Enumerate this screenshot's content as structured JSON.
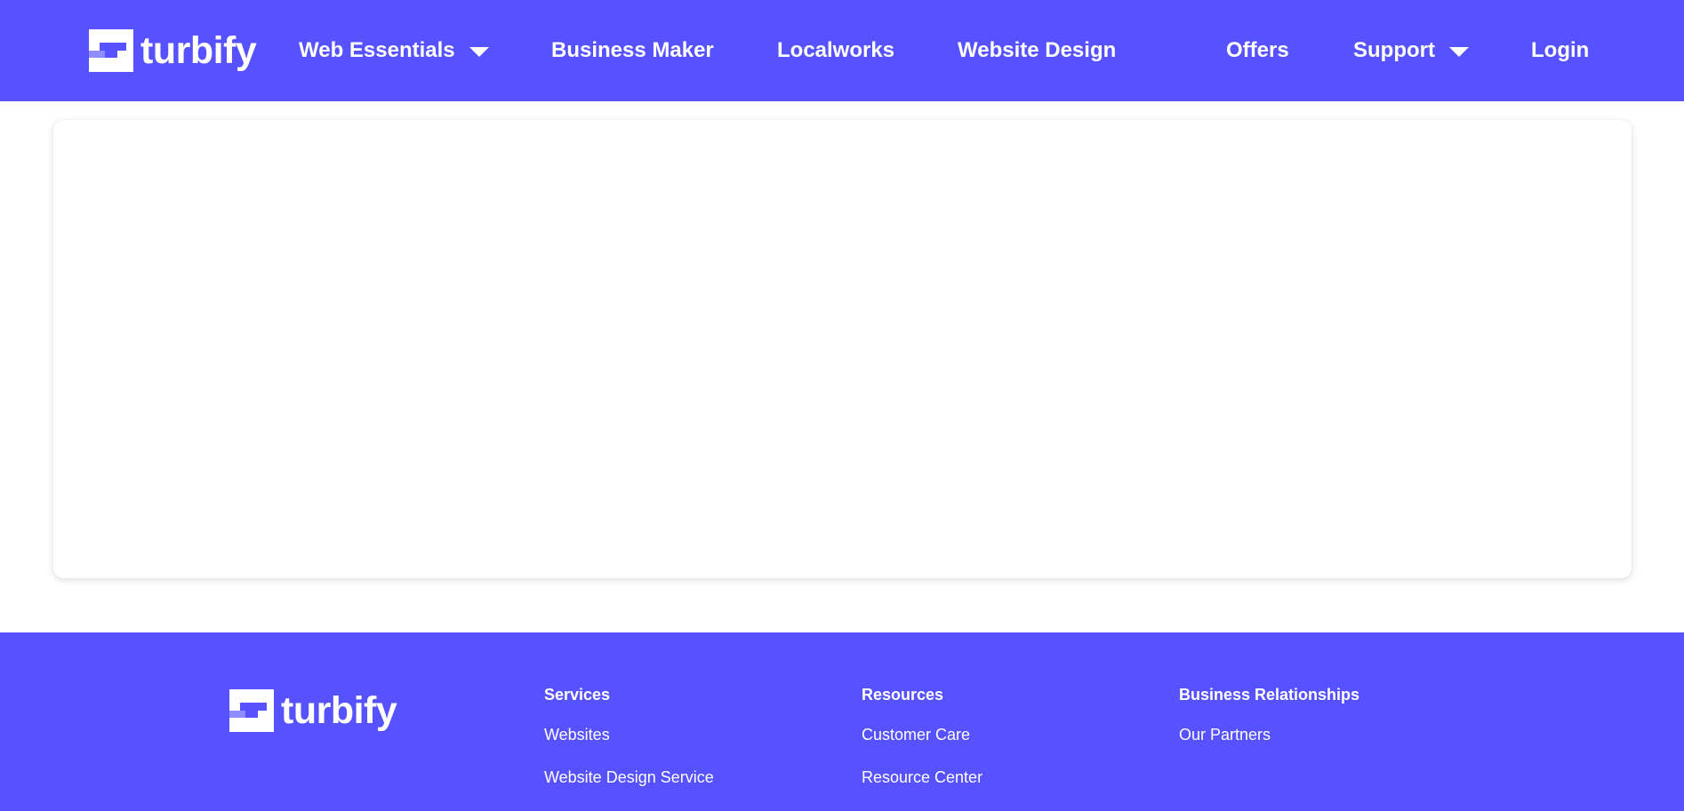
{
  "brand": {
    "name": "turbify",
    "colors": {
      "primary": "#5752ff",
      "text": "#ffffff",
      "logo_light": "#ffffff",
      "logo_mid": "#8f8cff",
      "logo_dark": "#5752ff"
    }
  },
  "nav": {
    "web_essentials": "Web Essentials",
    "business_maker": "Business Maker",
    "localworks": "Localworks",
    "website_design": "Website Design",
    "offers": "Offers",
    "support": "Support",
    "login": "Login",
    "dropdown_icon": "caret-down-icon"
  },
  "main": {
    "card": "empty content card"
  },
  "footer": {
    "columns": [
      {
        "title": "Services",
        "links": [
          "Websites",
          "Website Design Service"
        ]
      },
      {
        "title": "Resources",
        "links": [
          "Customer Care",
          "Resource Center"
        ]
      },
      {
        "title": "Business Relationships",
        "links": [
          "Our Partners"
        ]
      }
    ]
  }
}
